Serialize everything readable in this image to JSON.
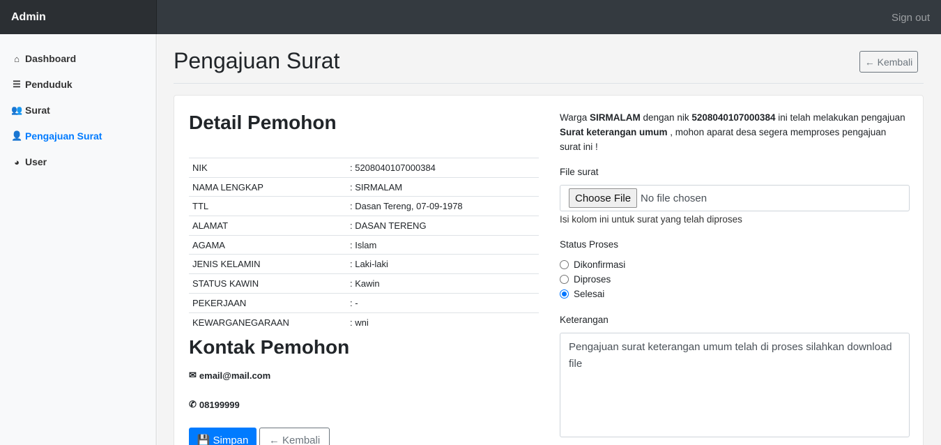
{
  "app": {
    "brand": "Admin",
    "signout": "Sign out"
  },
  "sidebar": {
    "items": [
      {
        "label": "Dashboard",
        "icon": "home-icon"
      },
      {
        "label": "Penduduk",
        "icon": "list-icon"
      },
      {
        "label": "Surat",
        "icon": "users-icon"
      },
      {
        "label": "Pengajuan Surat",
        "icon": "user-icon",
        "active": true
      },
      {
        "label": "User",
        "icon": "chart-pie-icon"
      }
    ]
  },
  "header": {
    "title": "Pengajuan Surat",
    "back_label": "Kembali"
  },
  "detail": {
    "title": "Detail Pemohon",
    "rows": [
      {
        "key": "NIK",
        "value": ": 5208040107000384"
      },
      {
        "key": "NAMA LENGKAP",
        "value": ": SIRMALAM"
      },
      {
        "key": "TTL",
        "value": ": Dasan Tereng, 07-09-1978"
      },
      {
        "key": "ALAMAT",
        "value": ": DASAN TERENG"
      },
      {
        "key": "AGAMA",
        "value": ": Islam"
      },
      {
        "key": "JENIS KELAMIN",
        "value": ": Laki-laki"
      },
      {
        "key": "STATUS KAWIN",
        "value": ": Kawin"
      },
      {
        "key": "PEKERJAAN",
        "value": ": -"
      },
      {
        "key": "KEWARGANEGARAAN",
        "value": ": wni"
      }
    ]
  },
  "kontak": {
    "title": "Kontak Pemohon",
    "email": "email@mail.com",
    "phone": "08199999"
  },
  "actions": {
    "save_label": "Simpan",
    "back_label": "Kembali"
  },
  "info": {
    "p1": "Warga ",
    "name": "SIRMALAM",
    "p2": " dengan nik ",
    "nik": "5208040107000384",
    "p3": " ini telah melakukan pengajuan ",
    "surat": "Surat keterangan umum",
    "p4": " , mohon aparat desa segera memproses pengajuan surat ini !"
  },
  "form": {
    "file_label": "File surat",
    "file_button": "Choose File",
    "file_status": "No file chosen",
    "file_help": "Isi kolom ini untuk surat yang telah diproses",
    "status_label": "Status Proses",
    "status_options": [
      "Dikonfirmasi",
      "Diproses",
      "Selesai"
    ],
    "status_selected": "Selesai",
    "keterangan_label": "Keterangan",
    "keterangan_value": "Pengajuan surat keterangan umum telah di proses silahkan download file"
  },
  "colors": {
    "primary": "#007bff",
    "topbar": "#343a40",
    "secondary": "#6c757d"
  }
}
